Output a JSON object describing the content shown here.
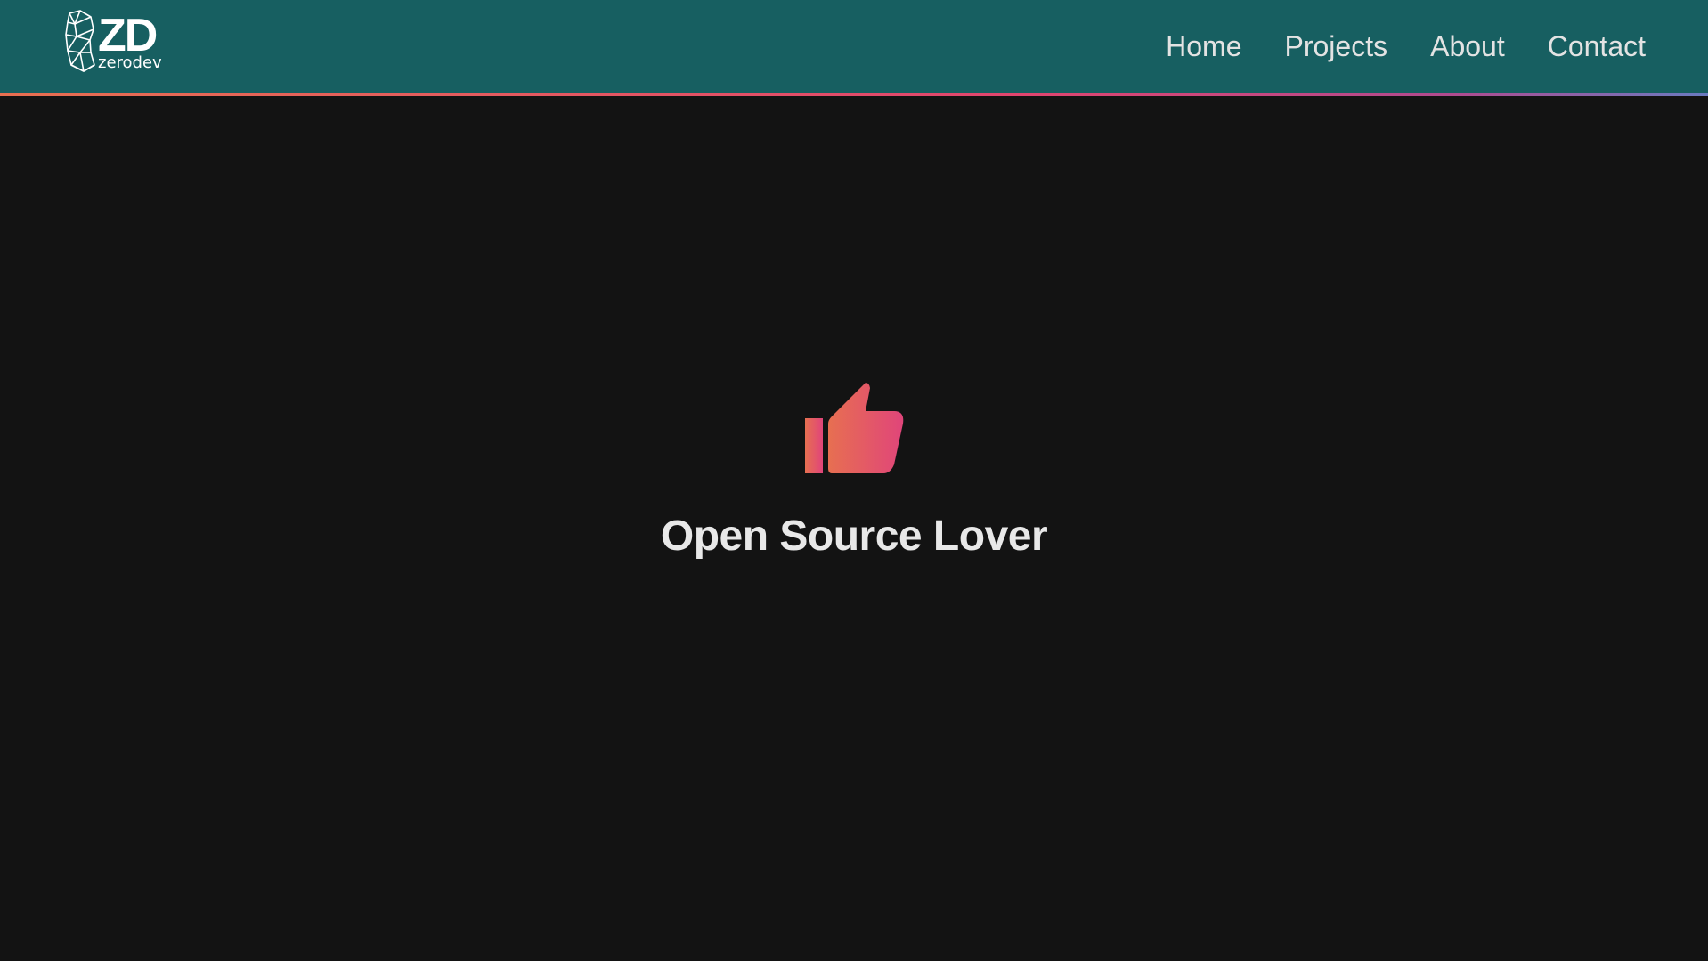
{
  "header": {
    "logo_mark": "ZD",
    "logo_word": "zerodev",
    "nav": [
      {
        "label": "Home"
      },
      {
        "label": "Projects"
      },
      {
        "label": "About"
      },
      {
        "label": "Contact"
      }
    ]
  },
  "hero": {
    "icon": "thumbs-up-icon",
    "title": "Open Source Lover"
  },
  "colors": {
    "header_bg": "#175f61",
    "page_bg": "#131313",
    "accent_start": "#e76f51",
    "accent_end": "#e0456f"
  }
}
